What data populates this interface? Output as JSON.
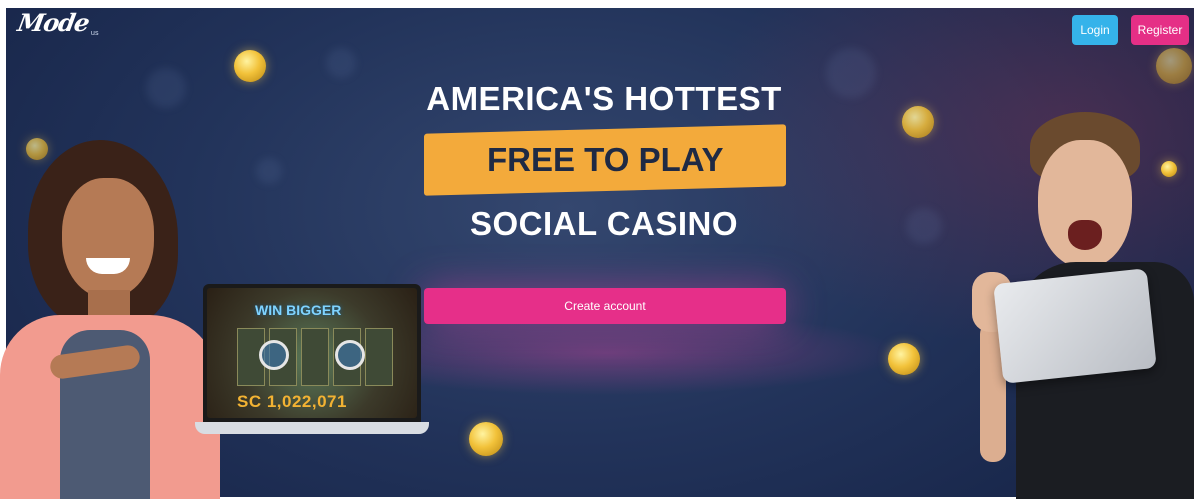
{
  "header": {
    "logo_text": "Mode",
    "logo_suffix": "us",
    "login_label": "Login",
    "register_label": "Register"
  },
  "hero": {
    "headline_top": "AMERICA'S HOTTEST",
    "headline_banner": "FREE TO PLAY",
    "headline_bottom": "SOCIAL CASINO",
    "cta_label": "Create account"
  },
  "laptop_game": {
    "title": "WIN BIGGER",
    "amount": "SC 1,022,071"
  },
  "colors": {
    "login_button": "#35b3ea",
    "register_button": "#e52f86",
    "cta_button": "#e62f89",
    "banner": "#f3aa3b",
    "background": "#22335a"
  },
  "icons": [
    "gold-coin-icon"
  ]
}
